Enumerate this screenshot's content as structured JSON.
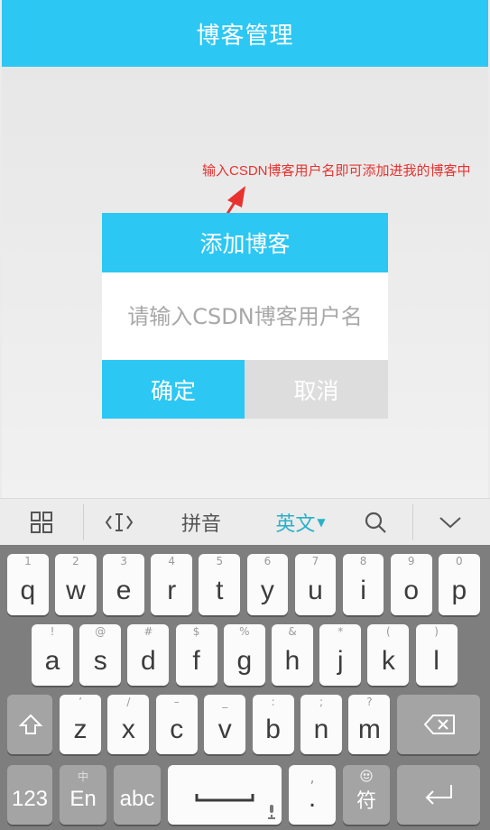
{
  "header": {
    "title": "博客管理"
  },
  "annotation": {
    "text": "输入CSDN博客用户名即可添加进我的博客中"
  },
  "dialog": {
    "title": "添加博客",
    "input_placeholder": "请输入CSDN博客用户名",
    "input_value": "",
    "ok_label": "确定",
    "cancel_label": "取消"
  },
  "keyboard_toolbar": {
    "pinyin_label": "拼音",
    "english_label": "英文",
    "icons": [
      "grid-icon",
      "cursor-icon",
      "search-icon",
      "chevron-down-icon"
    ],
    "active_color": "#2ab0c8"
  },
  "keyboard": {
    "row1": [
      {
        "main": "q",
        "hint": "1"
      },
      {
        "main": "w",
        "hint": "2"
      },
      {
        "main": "e",
        "hint": "3"
      },
      {
        "main": "r",
        "hint": "4"
      },
      {
        "main": "t",
        "hint": "5"
      },
      {
        "main": "y",
        "hint": "6"
      },
      {
        "main": "u",
        "hint": "7"
      },
      {
        "main": "i",
        "hint": "8"
      },
      {
        "main": "o",
        "hint": "9"
      },
      {
        "main": "p",
        "hint": "0"
      }
    ],
    "row2": [
      {
        "main": "a",
        "hint": "!"
      },
      {
        "main": "s",
        "hint": "@"
      },
      {
        "main": "d",
        "hint": "#"
      },
      {
        "main": "f",
        "hint": "$"
      },
      {
        "main": "g",
        "hint": "%"
      },
      {
        "main": "h",
        "hint": "&"
      },
      {
        "main": "j",
        "hint": "*"
      },
      {
        "main": "k",
        "hint": "("
      },
      {
        "main": "l",
        "hint": ")"
      }
    ],
    "row3": [
      {
        "main": "z",
        "hint": "’"
      },
      {
        "main": "x",
        "hint": "/"
      },
      {
        "main": "c",
        "hint": "–"
      },
      {
        "main": "v",
        "hint": "_"
      },
      {
        "main": "b",
        "hint": ":"
      },
      {
        "main": "n",
        "hint": ";"
      },
      {
        "main": "m",
        "hint": "?"
      }
    ],
    "num_label": "123",
    "lang_label": "En",
    "lang_hint": "中",
    "abc_label": "abc",
    "period_label": ".",
    "period_hint": ",",
    "symbol_label": "符",
    "icons": [
      "shift-icon",
      "backspace-icon",
      "space-bar-icon",
      "mic-icon",
      "emoji-icon",
      "enter-icon"
    ]
  }
}
